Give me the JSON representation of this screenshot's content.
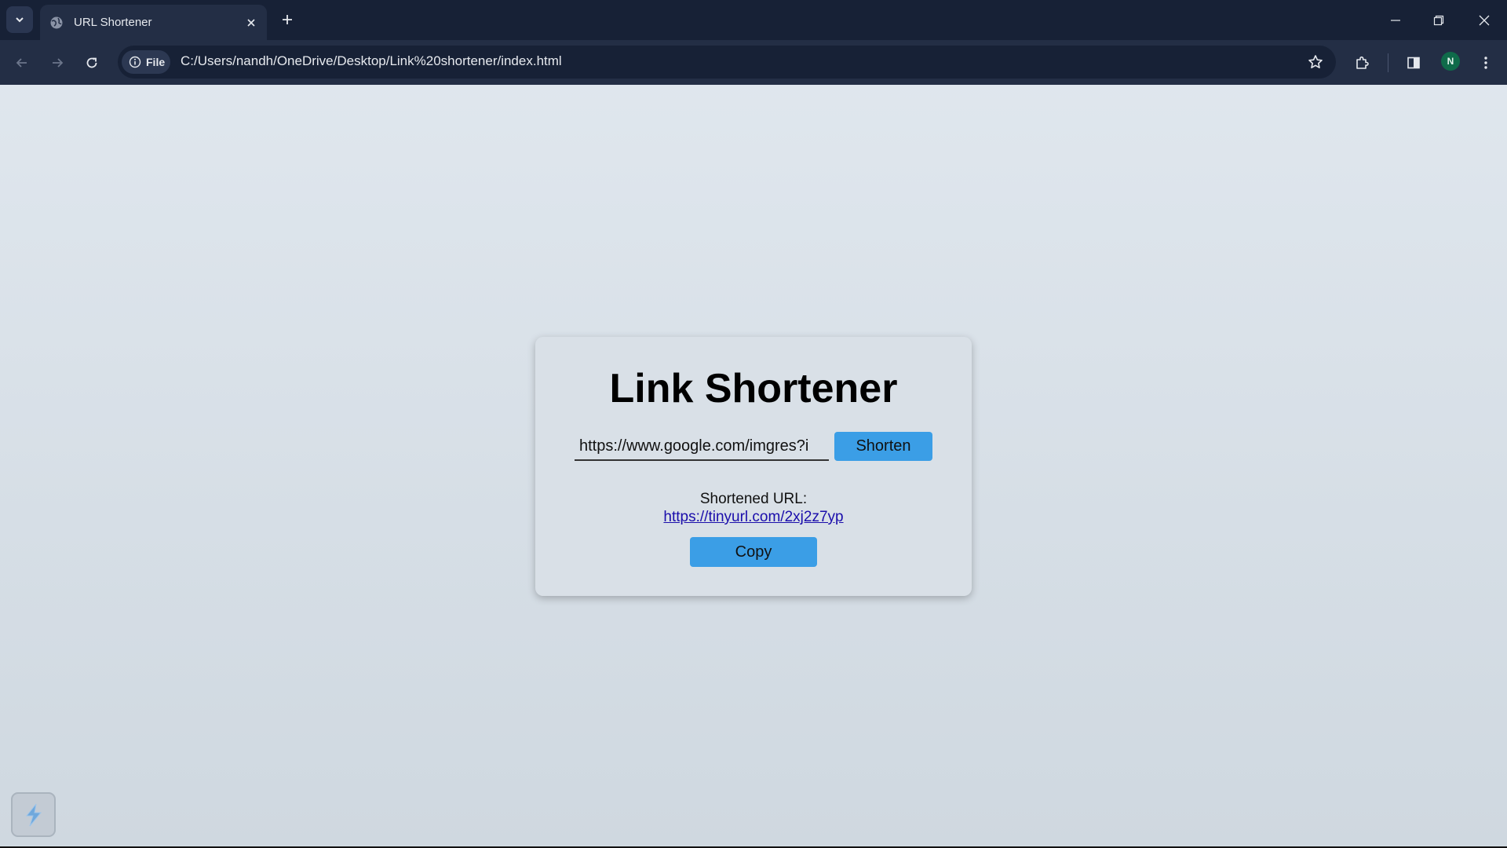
{
  "browser": {
    "tab_title": "URL Shortener",
    "address_chip": "File",
    "url": "C:/Users/nandh/OneDrive/Desktop/Link%20shortener/index.html",
    "profile_initial": "N"
  },
  "page": {
    "title": "Link Shortener",
    "input_value": "https://www.google.com/imgres?i",
    "shorten_label": "Shorten",
    "result_label": "Shortened URL:",
    "result_link": "https://tinyurl.com/2xj2z7yp",
    "copy_label": "Copy"
  },
  "colors": {
    "button": "#3b9ee6",
    "chrome_dark": "#172136",
    "link": "#1a0dab"
  }
}
